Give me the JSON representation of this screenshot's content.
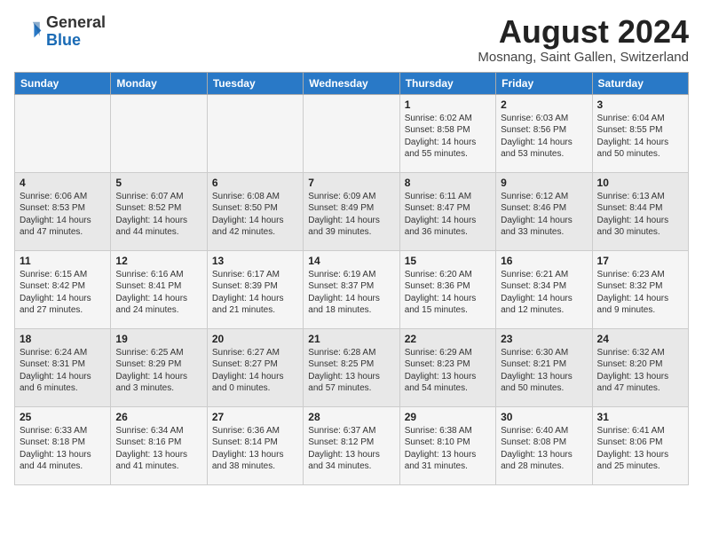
{
  "header": {
    "logo_general": "General",
    "logo_blue": "Blue",
    "title": "August 2024",
    "subtitle": "Mosnang, Saint Gallen, Switzerland"
  },
  "days_of_week": [
    "Sunday",
    "Monday",
    "Tuesday",
    "Wednesday",
    "Thursday",
    "Friday",
    "Saturday"
  ],
  "weeks": [
    [
      {
        "day": "",
        "info": ""
      },
      {
        "day": "",
        "info": ""
      },
      {
        "day": "",
        "info": ""
      },
      {
        "day": "",
        "info": ""
      },
      {
        "day": "1",
        "info": "Sunrise: 6:02 AM\nSunset: 8:58 PM\nDaylight: 14 hours\nand 55 minutes."
      },
      {
        "day": "2",
        "info": "Sunrise: 6:03 AM\nSunset: 8:56 PM\nDaylight: 14 hours\nand 53 minutes."
      },
      {
        "day": "3",
        "info": "Sunrise: 6:04 AM\nSunset: 8:55 PM\nDaylight: 14 hours\nand 50 minutes."
      }
    ],
    [
      {
        "day": "4",
        "info": "Sunrise: 6:06 AM\nSunset: 8:53 PM\nDaylight: 14 hours\nand 47 minutes."
      },
      {
        "day": "5",
        "info": "Sunrise: 6:07 AM\nSunset: 8:52 PM\nDaylight: 14 hours\nand 44 minutes."
      },
      {
        "day": "6",
        "info": "Sunrise: 6:08 AM\nSunset: 8:50 PM\nDaylight: 14 hours\nand 42 minutes."
      },
      {
        "day": "7",
        "info": "Sunrise: 6:09 AM\nSunset: 8:49 PM\nDaylight: 14 hours\nand 39 minutes."
      },
      {
        "day": "8",
        "info": "Sunrise: 6:11 AM\nSunset: 8:47 PM\nDaylight: 14 hours\nand 36 minutes."
      },
      {
        "day": "9",
        "info": "Sunrise: 6:12 AM\nSunset: 8:46 PM\nDaylight: 14 hours\nand 33 minutes."
      },
      {
        "day": "10",
        "info": "Sunrise: 6:13 AM\nSunset: 8:44 PM\nDaylight: 14 hours\nand 30 minutes."
      }
    ],
    [
      {
        "day": "11",
        "info": "Sunrise: 6:15 AM\nSunset: 8:42 PM\nDaylight: 14 hours\nand 27 minutes."
      },
      {
        "day": "12",
        "info": "Sunrise: 6:16 AM\nSunset: 8:41 PM\nDaylight: 14 hours\nand 24 minutes."
      },
      {
        "day": "13",
        "info": "Sunrise: 6:17 AM\nSunset: 8:39 PM\nDaylight: 14 hours\nand 21 minutes."
      },
      {
        "day": "14",
        "info": "Sunrise: 6:19 AM\nSunset: 8:37 PM\nDaylight: 14 hours\nand 18 minutes."
      },
      {
        "day": "15",
        "info": "Sunrise: 6:20 AM\nSunset: 8:36 PM\nDaylight: 14 hours\nand 15 minutes."
      },
      {
        "day": "16",
        "info": "Sunrise: 6:21 AM\nSunset: 8:34 PM\nDaylight: 14 hours\nand 12 minutes."
      },
      {
        "day": "17",
        "info": "Sunrise: 6:23 AM\nSunset: 8:32 PM\nDaylight: 14 hours\nand 9 minutes."
      }
    ],
    [
      {
        "day": "18",
        "info": "Sunrise: 6:24 AM\nSunset: 8:31 PM\nDaylight: 14 hours\nand 6 minutes."
      },
      {
        "day": "19",
        "info": "Sunrise: 6:25 AM\nSunset: 8:29 PM\nDaylight: 14 hours\nand 3 minutes."
      },
      {
        "day": "20",
        "info": "Sunrise: 6:27 AM\nSunset: 8:27 PM\nDaylight: 14 hours\nand 0 minutes."
      },
      {
        "day": "21",
        "info": "Sunrise: 6:28 AM\nSunset: 8:25 PM\nDaylight: 13 hours\nand 57 minutes."
      },
      {
        "day": "22",
        "info": "Sunrise: 6:29 AM\nSunset: 8:23 PM\nDaylight: 13 hours\nand 54 minutes."
      },
      {
        "day": "23",
        "info": "Sunrise: 6:30 AM\nSunset: 8:21 PM\nDaylight: 13 hours\nand 50 minutes."
      },
      {
        "day": "24",
        "info": "Sunrise: 6:32 AM\nSunset: 8:20 PM\nDaylight: 13 hours\nand 47 minutes."
      }
    ],
    [
      {
        "day": "25",
        "info": "Sunrise: 6:33 AM\nSunset: 8:18 PM\nDaylight: 13 hours\nand 44 minutes."
      },
      {
        "day": "26",
        "info": "Sunrise: 6:34 AM\nSunset: 8:16 PM\nDaylight: 13 hours\nand 41 minutes."
      },
      {
        "day": "27",
        "info": "Sunrise: 6:36 AM\nSunset: 8:14 PM\nDaylight: 13 hours\nand 38 minutes."
      },
      {
        "day": "28",
        "info": "Sunrise: 6:37 AM\nSunset: 8:12 PM\nDaylight: 13 hours\nand 34 minutes."
      },
      {
        "day": "29",
        "info": "Sunrise: 6:38 AM\nSunset: 8:10 PM\nDaylight: 13 hours\nand 31 minutes."
      },
      {
        "day": "30",
        "info": "Sunrise: 6:40 AM\nSunset: 8:08 PM\nDaylight: 13 hours\nand 28 minutes."
      },
      {
        "day": "31",
        "info": "Sunrise: 6:41 AM\nSunset: 8:06 PM\nDaylight: 13 hours\nand 25 minutes."
      }
    ]
  ]
}
